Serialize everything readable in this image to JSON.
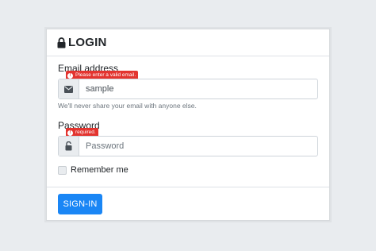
{
  "header": {
    "title": "LOGIN",
    "icon": "lock-icon"
  },
  "email": {
    "label": "Email address",
    "value": "sample",
    "error": "Please enter a valid email.",
    "help": "We'll never share your email with anyone else.",
    "icon": "envelope-icon"
  },
  "password": {
    "label": "Password",
    "placeholder": "Password",
    "error": "required.",
    "icon": "unlock-icon"
  },
  "remember": {
    "label": "Remember me",
    "checked": false
  },
  "submit": {
    "label": "SIGN-IN"
  },
  "colors": {
    "primary": "#1a86f5",
    "error": "#e3342f",
    "background": "#e9ecef"
  }
}
